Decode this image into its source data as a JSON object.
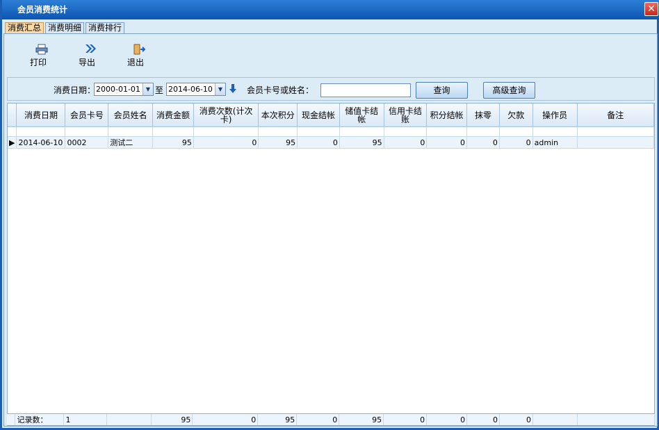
{
  "window": {
    "title": "会员消费统计",
    "close_glyph": "✕"
  },
  "tabs": [
    {
      "label": "消费汇总",
      "active": true
    },
    {
      "label": "消费明细",
      "active": false
    },
    {
      "label": "消费排行",
      "active": false
    }
  ],
  "toolbar": {
    "print": {
      "label": "打印",
      "icon": "printer-icon"
    },
    "export": {
      "label": "导出",
      "icon": "double-chevron-right-icon"
    },
    "exit": {
      "label": "退出",
      "icon": "exit-door-icon"
    }
  },
  "filter": {
    "date_label": "消费日期：",
    "date_from": "2000-01-01",
    "to_label": "至",
    "date_to": "2014-06-10",
    "member_label": "会员卡号或姓名：",
    "member_value": "",
    "query_button": "查询",
    "advanced_button": "高级查询"
  },
  "grid": {
    "columns": [
      "消费日期",
      "会员卡号",
      "会员姓名",
      "消费金额",
      "消费次数(计次卡)",
      "本次积分",
      "现金结帐",
      "储值卡结帐",
      "信用卡结账",
      "积分结帐",
      "抹零",
      "欠款",
      "操作员",
      "备注"
    ],
    "rows": [
      {
        "indicator": "▶",
        "cells": [
          "2014-06-10",
          "0002",
          "测试二",
          "95",
          "0",
          "95",
          "0",
          "95",
          "0",
          "0",
          "0",
          "0",
          "admin",
          ""
        ]
      }
    ]
  },
  "footer": {
    "label": "记录数：",
    "cells": [
      "1",
      "",
      "95",
      "0",
      "95",
      "0",
      "95",
      "0",
      "0",
      "0",
      "0",
      "",
      ""
    ]
  }
}
